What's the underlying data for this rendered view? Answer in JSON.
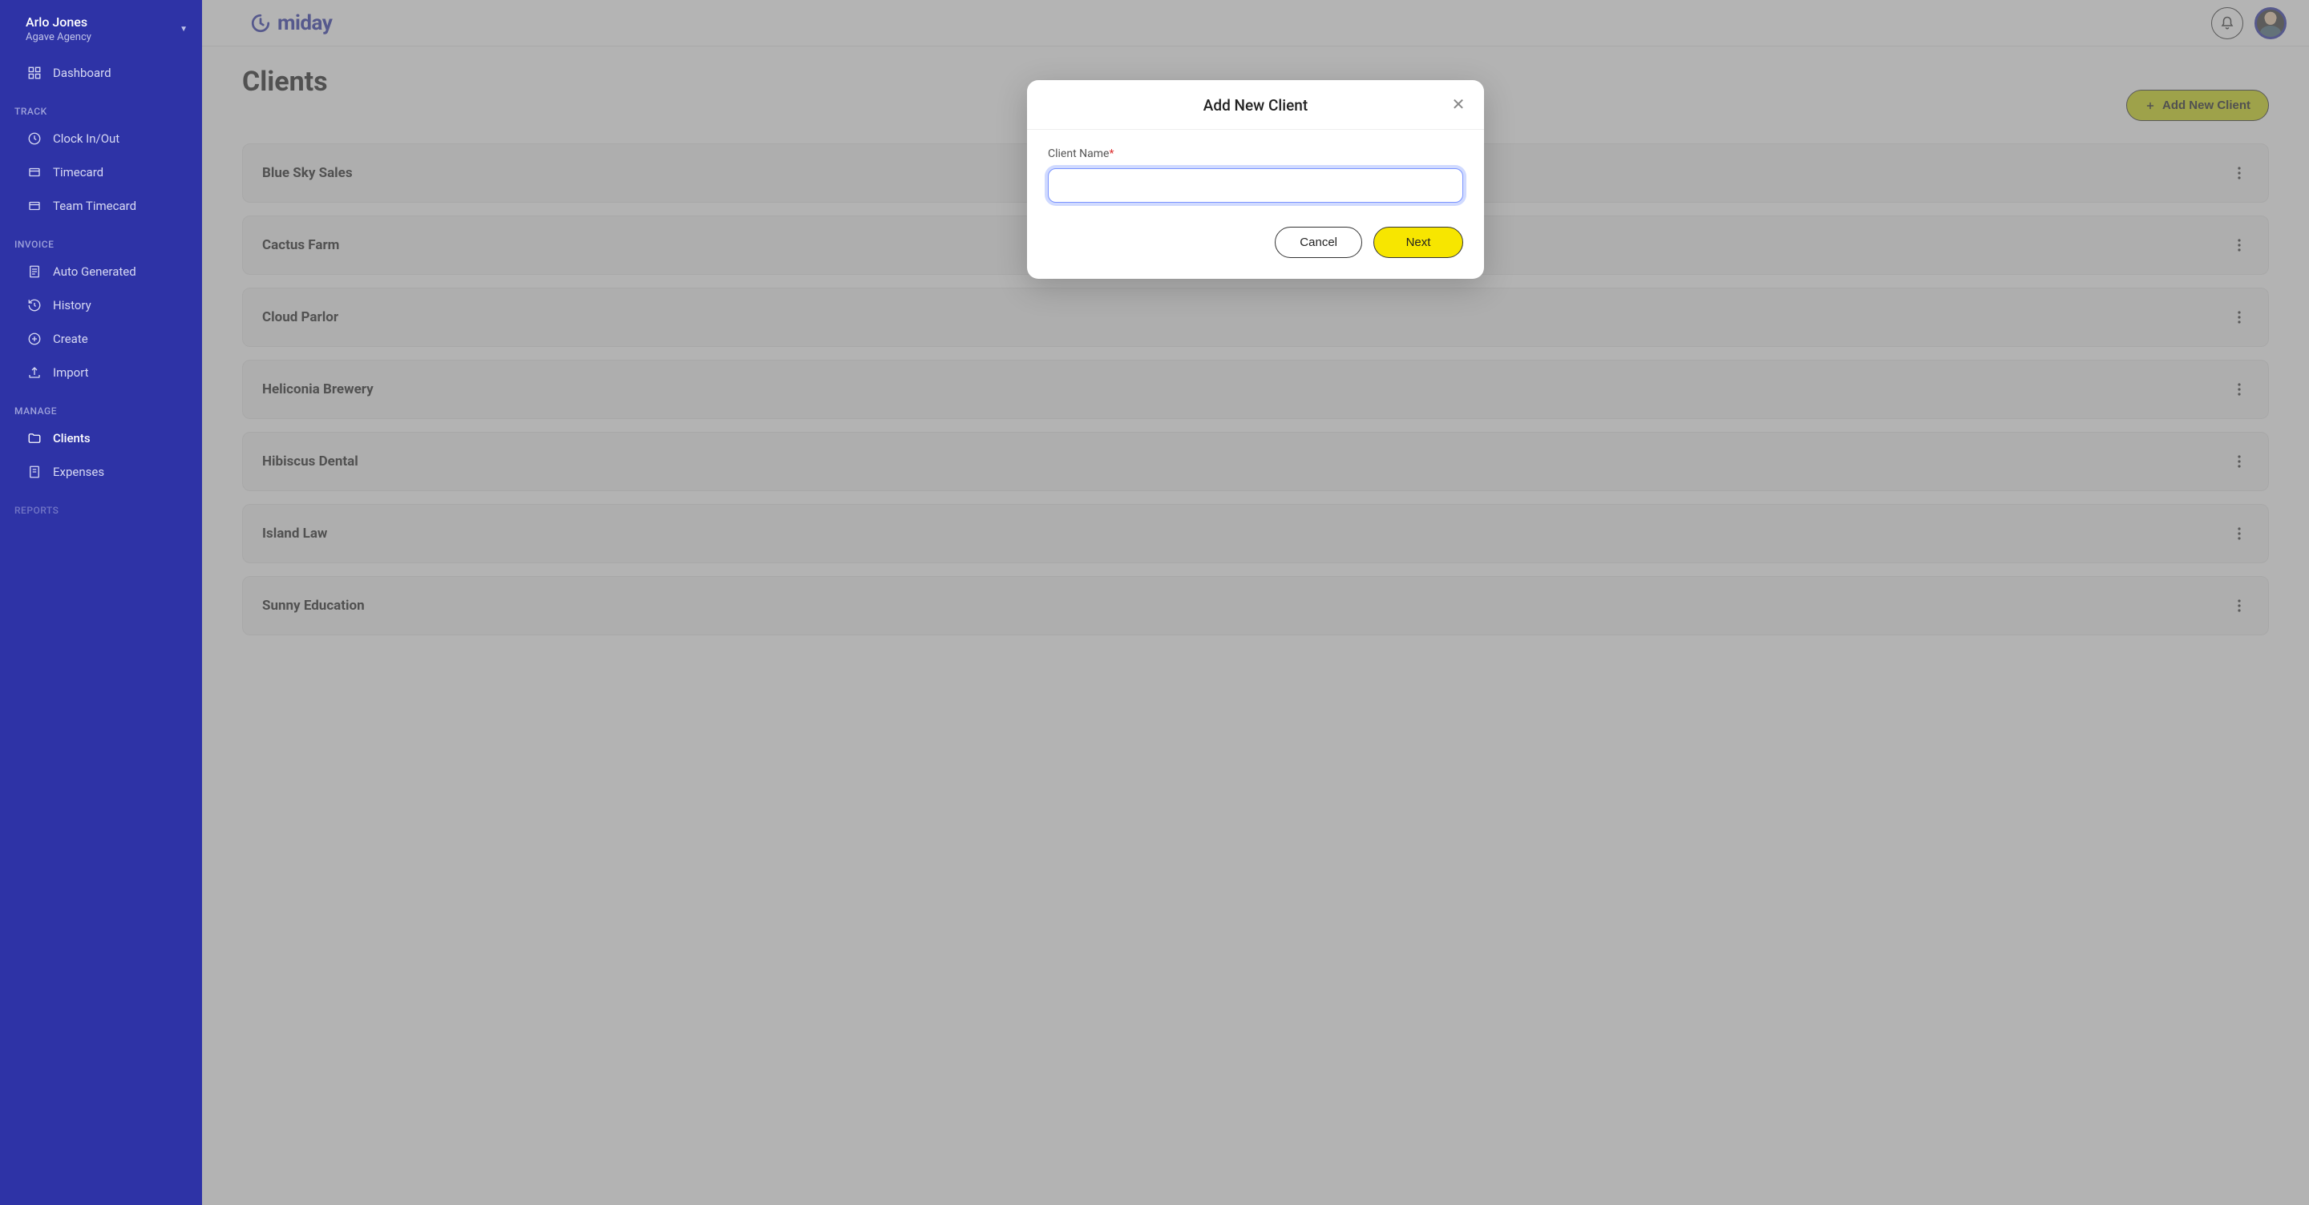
{
  "user": {
    "name": "Arlo Jones",
    "org": "Agave Agency"
  },
  "brand": "miday",
  "sidebar": {
    "dashboard": "Dashboard",
    "sections": {
      "track": {
        "label": "TRACK",
        "items": [
          "Clock In/Out",
          "Timecard",
          "Team Timecard"
        ]
      },
      "invoice": {
        "label": "INVOICE",
        "items": [
          "Auto Generated",
          "History",
          "Create",
          "Import"
        ]
      },
      "manage": {
        "label": "MANAGE",
        "items": [
          "Clients",
          "Expenses"
        ]
      },
      "reports": {
        "label": "REPORTS"
      }
    }
  },
  "page": {
    "title": "Clients",
    "add_button": "Add New Client"
  },
  "clients": [
    "Blue Sky Sales",
    "Cactus Farm",
    "Cloud Parlor",
    "Heliconia Brewery",
    "Hibiscus Dental",
    "Island Law",
    "Sunny Education"
  ],
  "modal": {
    "title": "Add New Client",
    "field_label": "Client Name",
    "required_mark": "*",
    "input_value": "",
    "cancel": "Cancel",
    "next": "Next"
  }
}
